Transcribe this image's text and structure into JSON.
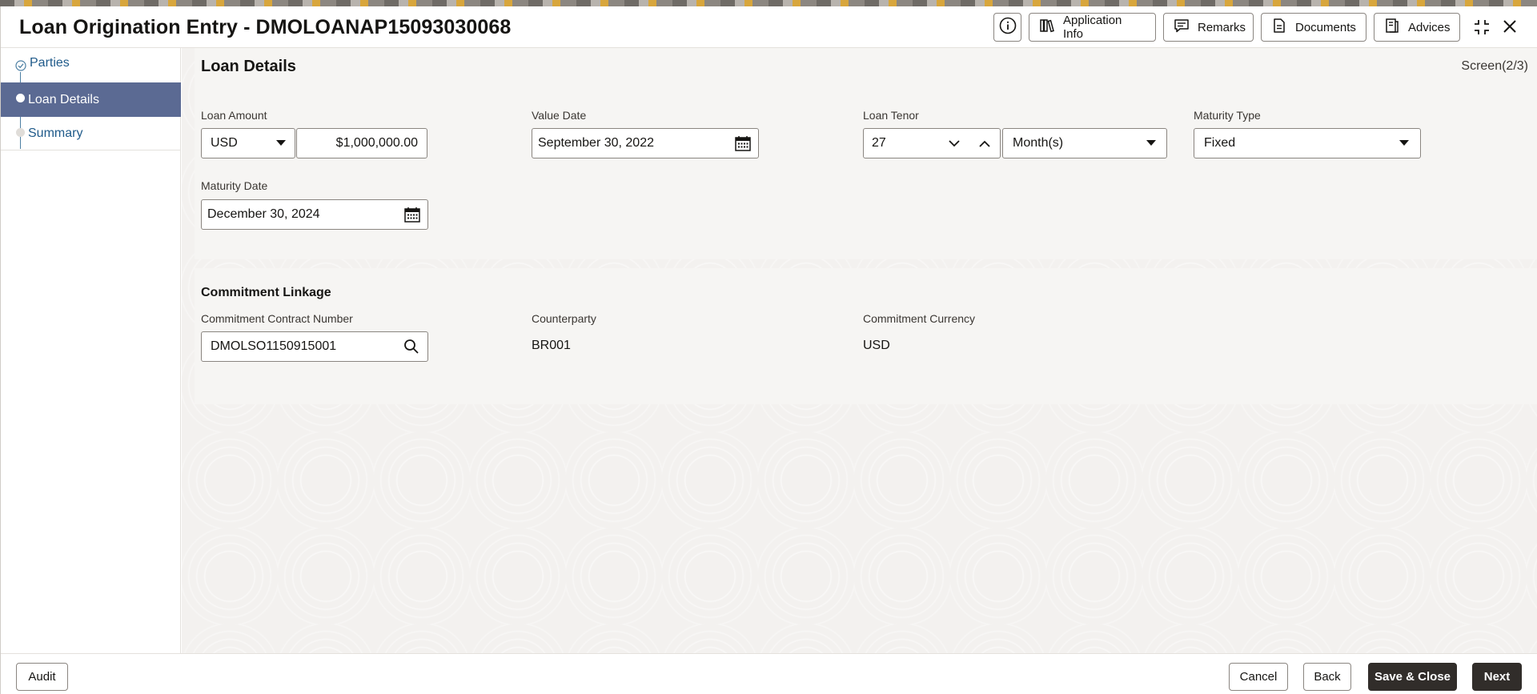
{
  "window": {
    "title": "Loan Origination Entry - DMOLOANAP15093030068"
  },
  "toolbar": {
    "application_info": "Application Info",
    "remarks": "Remarks",
    "documents": "Documents",
    "advices": "Advices"
  },
  "sidebar": {
    "steps": [
      {
        "label": "Parties",
        "state": "completed"
      },
      {
        "label": "Loan Details",
        "state": "active"
      },
      {
        "label": "Summary",
        "state": "pending"
      }
    ]
  },
  "loan_details": {
    "title": "Loan Details",
    "screen_indicator": "Screen(2/3)",
    "loan_amount": {
      "label": "Loan Amount",
      "currency": "USD",
      "amount": "$1,000,000.00"
    },
    "value_date": {
      "label": "Value Date",
      "value": "September 30, 2022"
    },
    "loan_tenor": {
      "label": "Loan Tenor",
      "value": "27",
      "unit": "Month(s)"
    },
    "maturity_type": {
      "label": "Maturity Type",
      "value": "Fixed"
    },
    "maturity_date": {
      "label": "Maturity Date",
      "value": "December 30, 2024"
    }
  },
  "commitment_linkage": {
    "title": "Commitment Linkage",
    "contract_number": {
      "label": "Commitment Contract Number",
      "value": "DMOLSO1150915001"
    },
    "counterparty": {
      "label": "Counterparty",
      "value": "BR001"
    },
    "currency": {
      "label": "Commitment Currency",
      "value": "USD"
    }
  },
  "footer": {
    "audit": "Audit",
    "cancel": "Cancel",
    "back": "Back",
    "save_close": "Save & Close",
    "next": "Next"
  },
  "colors": {
    "sidebar_active_bg": "#5b6a93",
    "link_blue": "#1f5a8a",
    "primary_button": "#312d2a"
  }
}
